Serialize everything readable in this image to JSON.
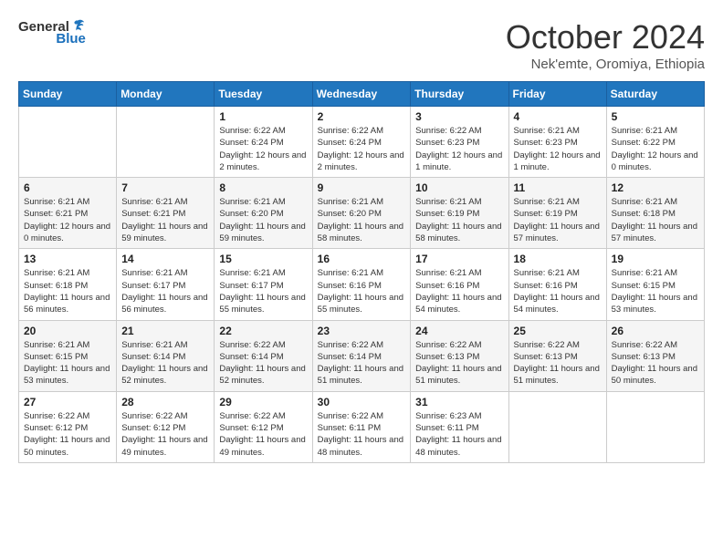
{
  "header": {
    "logo_general": "General",
    "logo_blue": "Blue",
    "month_title": "October 2024",
    "location": "Nek'emte, Oromiya, Ethiopia"
  },
  "days_of_week": [
    "Sunday",
    "Monday",
    "Tuesday",
    "Wednesday",
    "Thursday",
    "Friday",
    "Saturday"
  ],
  "weeks": [
    [
      {
        "day": "",
        "info": ""
      },
      {
        "day": "",
        "info": ""
      },
      {
        "day": "1",
        "info": "Sunrise: 6:22 AM\nSunset: 6:24 PM\nDaylight: 12 hours and 2 minutes."
      },
      {
        "day": "2",
        "info": "Sunrise: 6:22 AM\nSunset: 6:24 PM\nDaylight: 12 hours and 2 minutes."
      },
      {
        "day": "3",
        "info": "Sunrise: 6:22 AM\nSunset: 6:23 PM\nDaylight: 12 hours and 1 minute."
      },
      {
        "day": "4",
        "info": "Sunrise: 6:21 AM\nSunset: 6:23 PM\nDaylight: 12 hours and 1 minute."
      },
      {
        "day": "5",
        "info": "Sunrise: 6:21 AM\nSunset: 6:22 PM\nDaylight: 12 hours and 0 minutes."
      }
    ],
    [
      {
        "day": "6",
        "info": "Sunrise: 6:21 AM\nSunset: 6:21 PM\nDaylight: 12 hours and 0 minutes."
      },
      {
        "day": "7",
        "info": "Sunrise: 6:21 AM\nSunset: 6:21 PM\nDaylight: 11 hours and 59 minutes."
      },
      {
        "day": "8",
        "info": "Sunrise: 6:21 AM\nSunset: 6:20 PM\nDaylight: 11 hours and 59 minutes."
      },
      {
        "day": "9",
        "info": "Sunrise: 6:21 AM\nSunset: 6:20 PM\nDaylight: 11 hours and 58 minutes."
      },
      {
        "day": "10",
        "info": "Sunrise: 6:21 AM\nSunset: 6:19 PM\nDaylight: 11 hours and 58 minutes."
      },
      {
        "day": "11",
        "info": "Sunrise: 6:21 AM\nSunset: 6:19 PM\nDaylight: 11 hours and 57 minutes."
      },
      {
        "day": "12",
        "info": "Sunrise: 6:21 AM\nSunset: 6:18 PM\nDaylight: 11 hours and 57 minutes."
      }
    ],
    [
      {
        "day": "13",
        "info": "Sunrise: 6:21 AM\nSunset: 6:18 PM\nDaylight: 11 hours and 56 minutes."
      },
      {
        "day": "14",
        "info": "Sunrise: 6:21 AM\nSunset: 6:17 PM\nDaylight: 11 hours and 56 minutes."
      },
      {
        "day": "15",
        "info": "Sunrise: 6:21 AM\nSunset: 6:17 PM\nDaylight: 11 hours and 55 minutes."
      },
      {
        "day": "16",
        "info": "Sunrise: 6:21 AM\nSunset: 6:16 PM\nDaylight: 11 hours and 55 minutes."
      },
      {
        "day": "17",
        "info": "Sunrise: 6:21 AM\nSunset: 6:16 PM\nDaylight: 11 hours and 54 minutes."
      },
      {
        "day": "18",
        "info": "Sunrise: 6:21 AM\nSunset: 6:16 PM\nDaylight: 11 hours and 54 minutes."
      },
      {
        "day": "19",
        "info": "Sunrise: 6:21 AM\nSunset: 6:15 PM\nDaylight: 11 hours and 53 minutes."
      }
    ],
    [
      {
        "day": "20",
        "info": "Sunrise: 6:21 AM\nSunset: 6:15 PM\nDaylight: 11 hours and 53 minutes."
      },
      {
        "day": "21",
        "info": "Sunrise: 6:21 AM\nSunset: 6:14 PM\nDaylight: 11 hours and 52 minutes."
      },
      {
        "day": "22",
        "info": "Sunrise: 6:22 AM\nSunset: 6:14 PM\nDaylight: 11 hours and 52 minutes."
      },
      {
        "day": "23",
        "info": "Sunrise: 6:22 AM\nSunset: 6:14 PM\nDaylight: 11 hours and 51 minutes."
      },
      {
        "day": "24",
        "info": "Sunrise: 6:22 AM\nSunset: 6:13 PM\nDaylight: 11 hours and 51 minutes."
      },
      {
        "day": "25",
        "info": "Sunrise: 6:22 AM\nSunset: 6:13 PM\nDaylight: 11 hours and 51 minutes."
      },
      {
        "day": "26",
        "info": "Sunrise: 6:22 AM\nSunset: 6:13 PM\nDaylight: 11 hours and 50 minutes."
      }
    ],
    [
      {
        "day": "27",
        "info": "Sunrise: 6:22 AM\nSunset: 6:12 PM\nDaylight: 11 hours and 50 minutes."
      },
      {
        "day": "28",
        "info": "Sunrise: 6:22 AM\nSunset: 6:12 PM\nDaylight: 11 hours and 49 minutes."
      },
      {
        "day": "29",
        "info": "Sunrise: 6:22 AM\nSunset: 6:12 PM\nDaylight: 11 hours and 49 minutes."
      },
      {
        "day": "30",
        "info": "Sunrise: 6:22 AM\nSunset: 6:11 PM\nDaylight: 11 hours and 48 minutes."
      },
      {
        "day": "31",
        "info": "Sunrise: 6:23 AM\nSunset: 6:11 PM\nDaylight: 11 hours and 48 minutes."
      },
      {
        "day": "",
        "info": ""
      },
      {
        "day": "",
        "info": ""
      }
    ]
  ]
}
